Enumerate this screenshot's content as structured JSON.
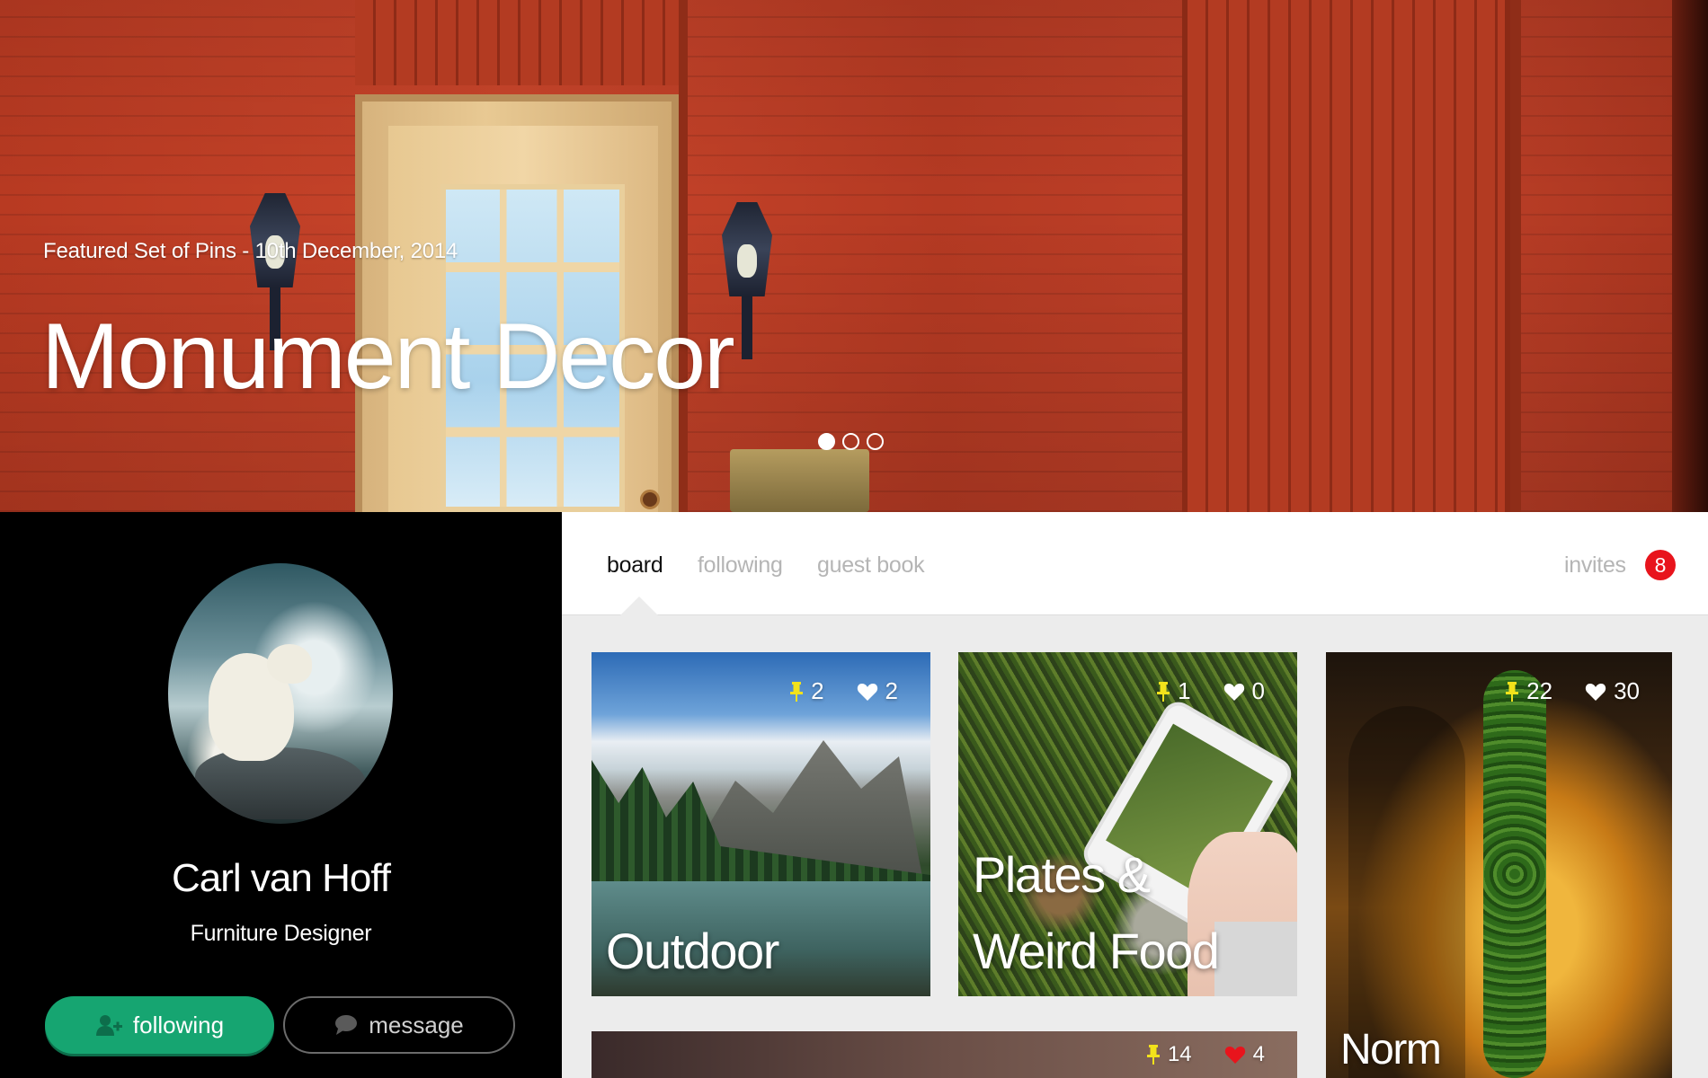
{
  "hero": {
    "subtitle": "Featured Set of Pins - 10th December, 2014",
    "title": "Monument Decor",
    "slides": [
      {
        "active": true
      },
      {
        "active": false
      },
      {
        "active": false
      }
    ]
  },
  "profile": {
    "name": "Carl van Hoff",
    "role": "Furniture Designer",
    "following_label": "following",
    "message_label": "message"
  },
  "tabs": {
    "board": "board",
    "following": "following",
    "guest_book": "guest book",
    "invites": "invites",
    "invites_count": "8"
  },
  "boards": [
    {
      "title": "Outdoor",
      "pins": "2",
      "likes": "2"
    },
    {
      "title_line1": "Plates &",
      "title_line2": "Weird Food",
      "pins": "1",
      "likes": "0"
    },
    {
      "title": "Norm",
      "pins": "22",
      "likes": "30"
    },
    {
      "pins": "14",
      "likes": "4"
    }
  ],
  "colors": {
    "accent_green": "#16a571",
    "badge_red": "#e8141c",
    "pin_yellow": "#f2e21b"
  },
  "icons": {
    "pin": "pin-icon",
    "heart": "heart-icon",
    "add_user": "add-user-icon",
    "chat": "chat-bubble-icon"
  }
}
